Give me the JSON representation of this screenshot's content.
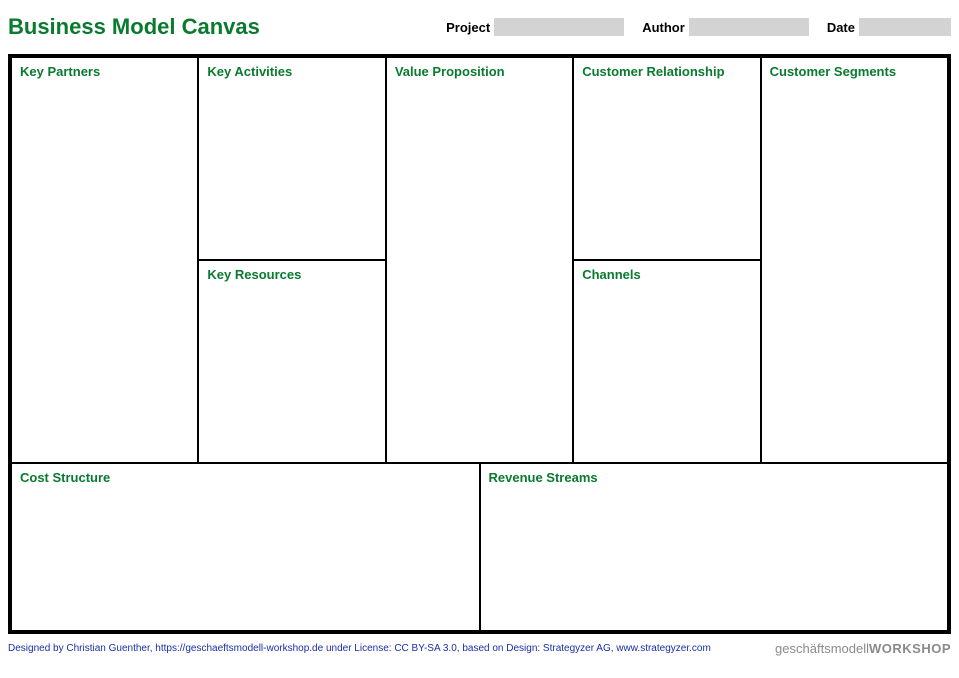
{
  "title": "Business Model Canvas",
  "header": {
    "project_label": "Project",
    "author_label": "Author",
    "date_label": "Date",
    "project_value": "",
    "author_value": "",
    "date_value": ""
  },
  "cells": {
    "key_partners": "Key Partners",
    "key_activities": "Key Activities",
    "key_resources": "Key Resources",
    "value_proposition": "Value Proposition",
    "customer_relationship": "Customer Relationship",
    "channels": "Channels",
    "customer_segments": "Customer Segments",
    "cost_structure": "Cost Structure",
    "revenue_streams": "Revenue Streams"
  },
  "footer": {
    "attribution": "Designed by Christian Guenther, https://geschaeftsmodell-workshop.de under License: CC BY-SA 3.0, based on Design: Strategyzer AG, www.strategyzer.com",
    "logo_light": "geschäftsmodell",
    "logo_bold": "WORKSHOP"
  }
}
